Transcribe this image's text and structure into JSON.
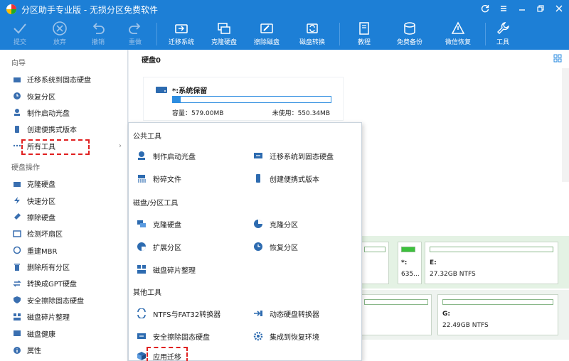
{
  "titlebar": {
    "title": "分区助手专业版 - 无损分区免费软件"
  },
  "toolbar": {
    "commit": "提交",
    "discard": "放弃",
    "undo": "撤销",
    "redo": "重做",
    "migrate_os": "迁移系统",
    "clone_disk": "克隆硬盘",
    "wipe_disk": "擦除磁盘",
    "disk_convert": "磁盘转换",
    "tutorial": "教程",
    "free_backup": "免费备份",
    "wechat_restore": "微信恢复",
    "tools": "工具"
  },
  "sidebar": {
    "wizard_head": "向导",
    "wizard_items": [
      {
        "label": "迁移系统到固态硬盘",
        "icon": "ssd-icon"
      },
      {
        "label": "恢复分区",
        "icon": "recover-icon"
      },
      {
        "label": "制作启动光盘",
        "icon": "bootdisk-icon"
      },
      {
        "label": "创建便携式版本",
        "icon": "portable-icon"
      },
      {
        "label": "所有工具",
        "icon": "more-icon"
      }
    ],
    "disk_head": "硬盘操作",
    "disk_items": [
      {
        "label": "克隆硬盘"
      },
      {
        "label": "快速分区"
      },
      {
        "label": "擦除硬盘"
      },
      {
        "label": "检测坏扇区"
      },
      {
        "label": "重建MBR"
      },
      {
        "label": "删除所有分区"
      },
      {
        "label": "转换成GPT硬盘"
      },
      {
        "label": "安全擦除固态硬盘"
      },
      {
        "label": "磁盘碎片整理"
      },
      {
        "label": "磁盘健康"
      },
      {
        "label": "属性"
      }
    ]
  },
  "main": {
    "disk_title": "硬盘0",
    "partition": {
      "name": "*:系统保留",
      "capacity": "容量：579.00MB",
      "unused": "未使用：550.34MB",
      "used_fraction": 0.05
    },
    "tiles": [
      {
        "label": "*:",
        "size": "635..."
      },
      {
        "label": "E:",
        "size": "27.32GB NTFS"
      },
      {
        "label": "G:",
        "size": "22.49GB NTFS"
      }
    ]
  },
  "popup": {
    "public_head": "公共工具",
    "public_items": [
      "制作启动光盘",
      "迁移系统到固态硬盘",
      "粉碎文件",
      "创建便携式版本"
    ],
    "disk_head": "磁盘/分区工具",
    "disk_items": [
      "克隆硬盘",
      "克隆分区",
      "扩展分区",
      "恢复分区",
      "磁盘碎片整理"
    ],
    "other_head": "其他工具",
    "other_items": [
      "NTFS与FAT32转换器",
      "动态硬盘转换器",
      "安全擦除固态硬盘",
      "集成到恢复环境",
      "应用迁移"
    ]
  },
  "colors": {
    "accent": "#1d7fd6",
    "highlight": "#e02020"
  }
}
